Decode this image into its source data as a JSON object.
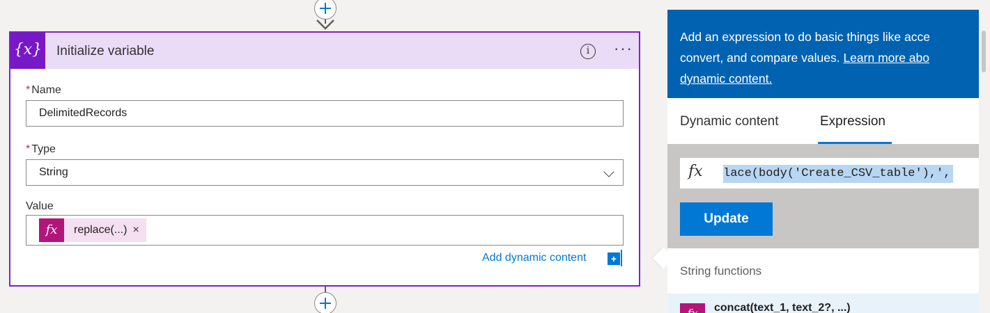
{
  "card": {
    "title": "Initialize variable",
    "icon_glyph": "{x}",
    "name_label": "Name",
    "name_value": "DelimitedRecords",
    "type_label": "Type",
    "type_value": "String",
    "value_label": "Value",
    "token_label": "replace(...)",
    "token_remove": "×",
    "add_dynamic_label": "Add dynamic content",
    "required_mark": "*",
    "info_glyph": "i",
    "more_glyph": "···"
  },
  "panel": {
    "banner_text": "Add an expression to do basic things like acce",
    "banner_text_2": "convert, and compare values.",
    "banner_link_1": "Learn more abo",
    "banner_link_2": "dynamic content.",
    "tabs": [
      {
        "label": "Dynamic content",
        "selected": false
      },
      {
        "label": "Expression",
        "selected": true
      }
    ],
    "expression_text": "lace(body('Create_CSV_table'),',",
    "fx_glyph": "fx",
    "update_label": "Update",
    "section_title": "String functions",
    "functions": [
      {
        "label": "concat(text_1, text_2?, ...)"
      }
    ]
  },
  "colors": {
    "card_border": "#7f1fd1",
    "card_header": "#eadcf7",
    "card_icon": "#7719c6",
    "token_icon": "#b3157a",
    "accent": "#0078d4",
    "banner": "#0062b1"
  },
  "icons": [
    "variable-icon",
    "info-icon",
    "more-icon",
    "chevron-down-icon",
    "fx-icon",
    "remove-icon",
    "plus-icon"
  ]
}
